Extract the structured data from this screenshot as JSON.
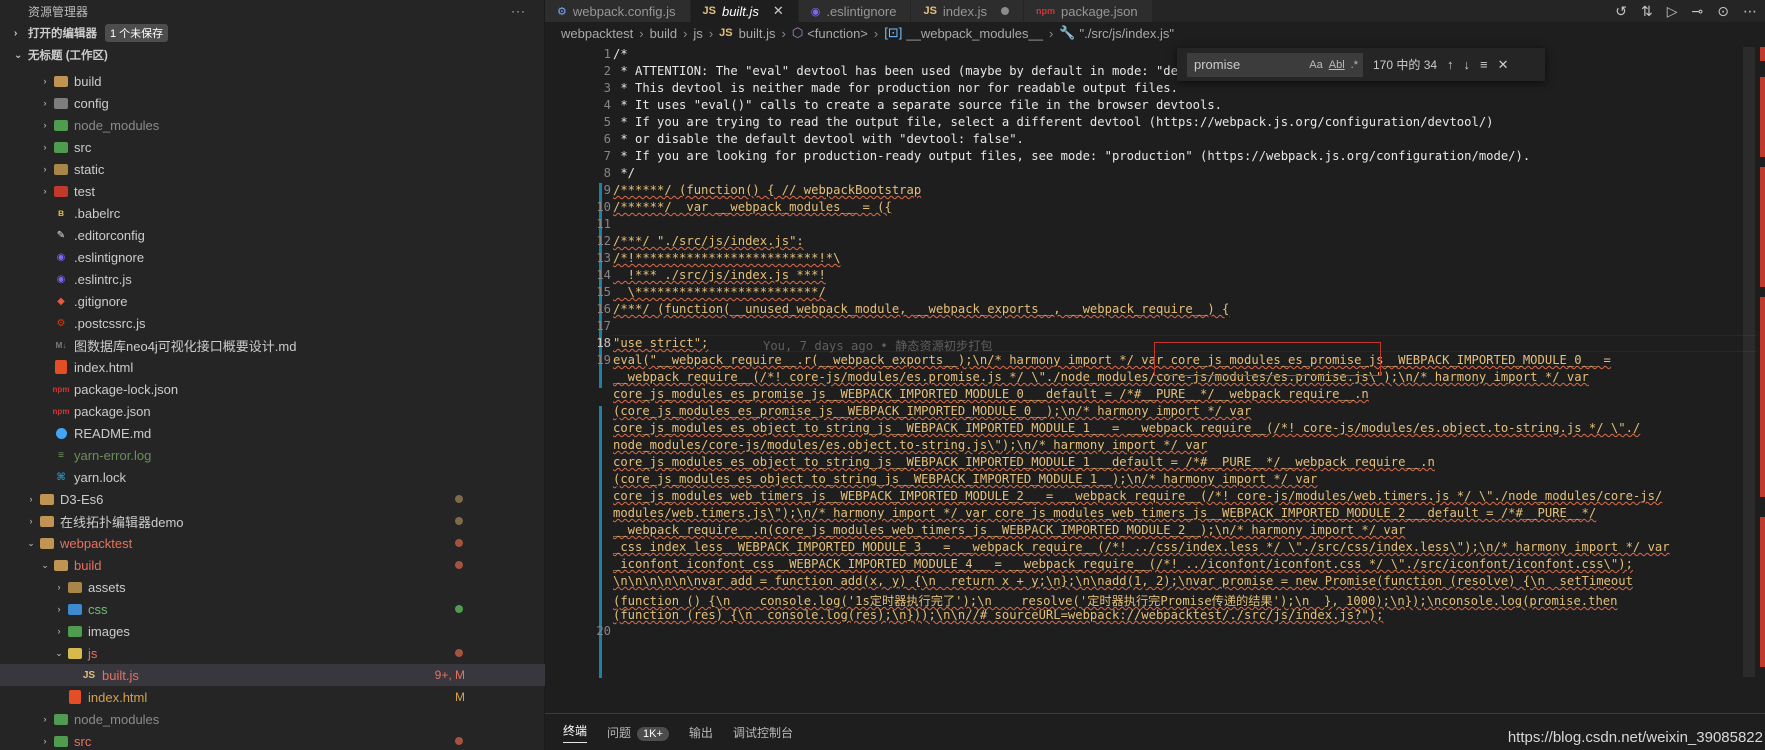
{
  "sidebar": {
    "title": "资源管理器",
    "more": "···",
    "open_editors": {
      "label": "打开的编辑器",
      "badge": "1 个未保存"
    },
    "workspace": {
      "label": "无标题 (工作区)"
    },
    "tree": [
      {
        "label": "build",
        "kind": "folder",
        "color": "#c09553"
      },
      {
        "label": "config",
        "kind": "folder",
        "color": "#7d7d7d"
      },
      {
        "label": "node_modules",
        "kind": "folder",
        "color": "#4f9b4f"
      },
      {
        "label": "src",
        "kind": "folder",
        "color": "#4f9b4f"
      },
      {
        "label": "static",
        "kind": "folder",
        "color": "#a98548"
      },
      {
        "label": "test",
        "kind": "folder",
        "color": "#c0392b"
      },
      {
        "label": ".babelrc",
        "kind": "file",
        "icon": "babel-icon"
      },
      {
        "label": ".editorconfig",
        "kind": "file",
        "icon": "editorconfig-icon"
      },
      {
        "label": ".eslintignore",
        "kind": "file",
        "icon": "eslint-icon"
      },
      {
        "label": ".eslintrc.js",
        "kind": "file",
        "icon": "eslint-icon"
      },
      {
        "label": ".gitignore",
        "kind": "file",
        "icon": "git-icon"
      },
      {
        "label": ".postcssrc.js",
        "kind": "file",
        "icon": "postcss-icon"
      },
      {
        "label": "图数据库neo4j可视化接口概要设计.md",
        "kind": "file",
        "icon": "markdown-icon"
      },
      {
        "label": "index.html",
        "kind": "file",
        "icon": "html5-icon"
      },
      {
        "label": "package-lock.json",
        "kind": "file",
        "icon": "npm-icon"
      },
      {
        "label": "package.json",
        "kind": "file",
        "icon": "npm-icon"
      },
      {
        "label": "README.md",
        "kind": "file",
        "icon": "info-icon"
      },
      {
        "label": "yarn-error.log",
        "kind": "file",
        "icon": "log-icon"
      },
      {
        "label": "yarn.lock",
        "kind": "file",
        "icon": "yarn-icon"
      },
      {
        "label": "D3-Es6",
        "kind": "root"
      },
      {
        "label": "在线拓扑编辑器demo",
        "kind": "root"
      },
      {
        "label": "webpacktest",
        "kind": "root-open"
      },
      {
        "label": "build",
        "kind": "subfolder-open"
      },
      {
        "label": "assets",
        "kind": "subfolder"
      },
      {
        "label": "css",
        "kind": "subfolder"
      },
      {
        "label": "images",
        "kind": "subfolder"
      },
      {
        "label": "js",
        "kind": "subfolder-open"
      },
      {
        "label": "built.js",
        "kind": "selected",
        "status": "9+, M"
      },
      {
        "label": "index.html",
        "kind": "file2",
        "status": "M"
      },
      {
        "label": "node_modules",
        "kind": "subfolder"
      },
      {
        "label": "src",
        "kind": "subfolder"
      }
    ]
  },
  "tabs": [
    {
      "label": "webpack.config.js",
      "icon": "gear",
      "active": false
    },
    {
      "label": "built.js",
      "icon": "JS",
      "active": true,
      "close": "✕"
    },
    {
      "label": ".eslintignore",
      "icon": "eslint",
      "active": false
    },
    {
      "label": "index.js",
      "icon": "JS",
      "active": false
    },
    {
      "label": "package.json",
      "icon": "npm",
      "active": false
    }
  ],
  "breadcrumb": [
    "webpacktest",
    "build",
    "js",
    "built.js",
    "<function>",
    "__webpack_modules__",
    "\"./src/js/index.js\""
  ],
  "find": {
    "query": "promise",
    "opt_case": "Aa",
    "opt_word": "Abl",
    "opt_regex": ".*",
    "count": "170 中的 34"
  },
  "code": {
    "line_numbers": [
      "1",
      "2",
      "3",
      "4",
      "5",
      "6",
      "7",
      "8",
      "9",
      "10",
      "11",
      "12",
      "13",
      "14",
      "15",
      "16",
      "17",
      "18",
      "19",
      "20"
    ],
    "lines": [
      "/*",
      " * ATTENTION: The \"eval\" devtool has been used (maybe by default in mode: \"development\").",
      " * This devtool is neither made for production nor for readable output files.",
      " * It uses \"eval()\" calls to create a separate source file in the browser devtools.",
      " * If you are trying to read the output file, select a different devtool (https://webpack.js.org/configuration/devtool/)",
      " * or disable the default devtool with \"devtool: false\".",
      " * If you are looking for production-ready output files, see mode: \"production\" (https://webpack.js.org/configuration/mode/).",
      " */",
      "/******/ (function() { // webpackBootstrap",
      "/******/  var __webpack_modules__ = ({",
      "",
      "/***/ \"./src/js/index.js\":",
      "/*!*************************!*\\",
      "  !*** ./src/js/index.js ***!",
      "  \\*************************/",
      "/***/ (function(__unused_webpack_module, __webpack_exports__, __webpack_require__) {",
      "",
      "\"use strict\";"
    ],
    "blame": "You, 7 days ago • 静态资源初步打包",
    "eval_lines": [
      "eval(\"__webpack_require__.r(__webpack_exports__);\\n/* harmony import */ var core_js_modules_es_promise_js__WEBPACK_IMPORTED_MODULE_0__ =",
      "__webpack_require__(/*! core-js/modules/es.promise.js */ \\\"./node_modules/core-js/modules/es.promise.js\\\");\\n/* harmony import */ var",
      "core_js_modules_es_promise_js__WEBPACK_IMPORTED_MODULE_0___default = /*#__PURE__*/__webpack_require__.n",
      "(core_js_modules_es_promise_js__WEBPACK_IMPORTED_MODULE_0__);\\n/* harmony import */ var",
      "core_js_modules_es_object_to_string_js__WEBPACK_IMPORTED_MODULE_1__ = __webpack_require__(/*! core-js/modules/es.object.to-string.js */ \\\"./",
      "node_modules/core-js/modules/es.object.to-string.js\\\");\\n/* harmony import */ var",
      "core_js_modules_es_object_to_string_js__WEBPACK_IMPORTED_MODULE_1___default = /*#__PURE__*/__webpack_require__.n",
      "(core_js_modules_es_object_to_string_js__WEBPACK_IMPORTED_MODULE_1__);\\n/* harmony import */ var",
      "core_js_modules_web_timers_js__WEBPACK_IMPORTED_MODULE_2__ = __webpack_require__(/*! core-js/modules/web.timers.js */ \\\"./node_modules/core-js/",
      "modules/web.timers.js\\\");\\n/* harmony import */ var core_js_modules_web_timers_js__WEBPACK_IMPORTED_MODULE_2___default = /*#__PURE__*/",
      "__webpack_require__.n(core_js_modules_web_timers_js__WEBPACK_IMPORTED_MODULE_2__);\\n/* harmony import */ var",
      "_css_index_less__WEBPACK_IMPORTED_MODULE_3__ = __webpack_require__(/*! ../css/index.less */ \\\"./src/css/index.less\\\");\\n/* harmony import */ var",
      "_iconfont_iconfont_css__WEBPACK_IMPORTED_MODULE_4__ = __webpack_require__(/*! ../iconfont/iconfont.css */ \\\"./src/iconfont/iconfont.css\\\");",
      "\\n\\n\\n\\n\\n\\nvar add = function add(x, y) {\\n  return x + y;\\n};\\n\\nadd(1, 2);\\nvar promise = new Promise(function (resolve) {\\n  setTimeout",
      "(function () {\\n    console.log('1s定时器执行完了');\\n    resolve('定时器执行完Promise传递的结果');\\n  }, 1000);\\n});\\nconsole.log(promise.then",
      "(function (res) {\\n  console.log(res);\\n}));\\n\\n//# sourceURL=webpack://webpacktest/./src/js/index.js?\");"
    ]
  },
  "panel": {
    "tabs": [
      "终端",
      "问题",
      "输出",
      "调试控制台"
    ],
    "problems_badge": "1K+"
  },
  "watermark": "https://blog.csdn.net/weixin_39085822"
}
